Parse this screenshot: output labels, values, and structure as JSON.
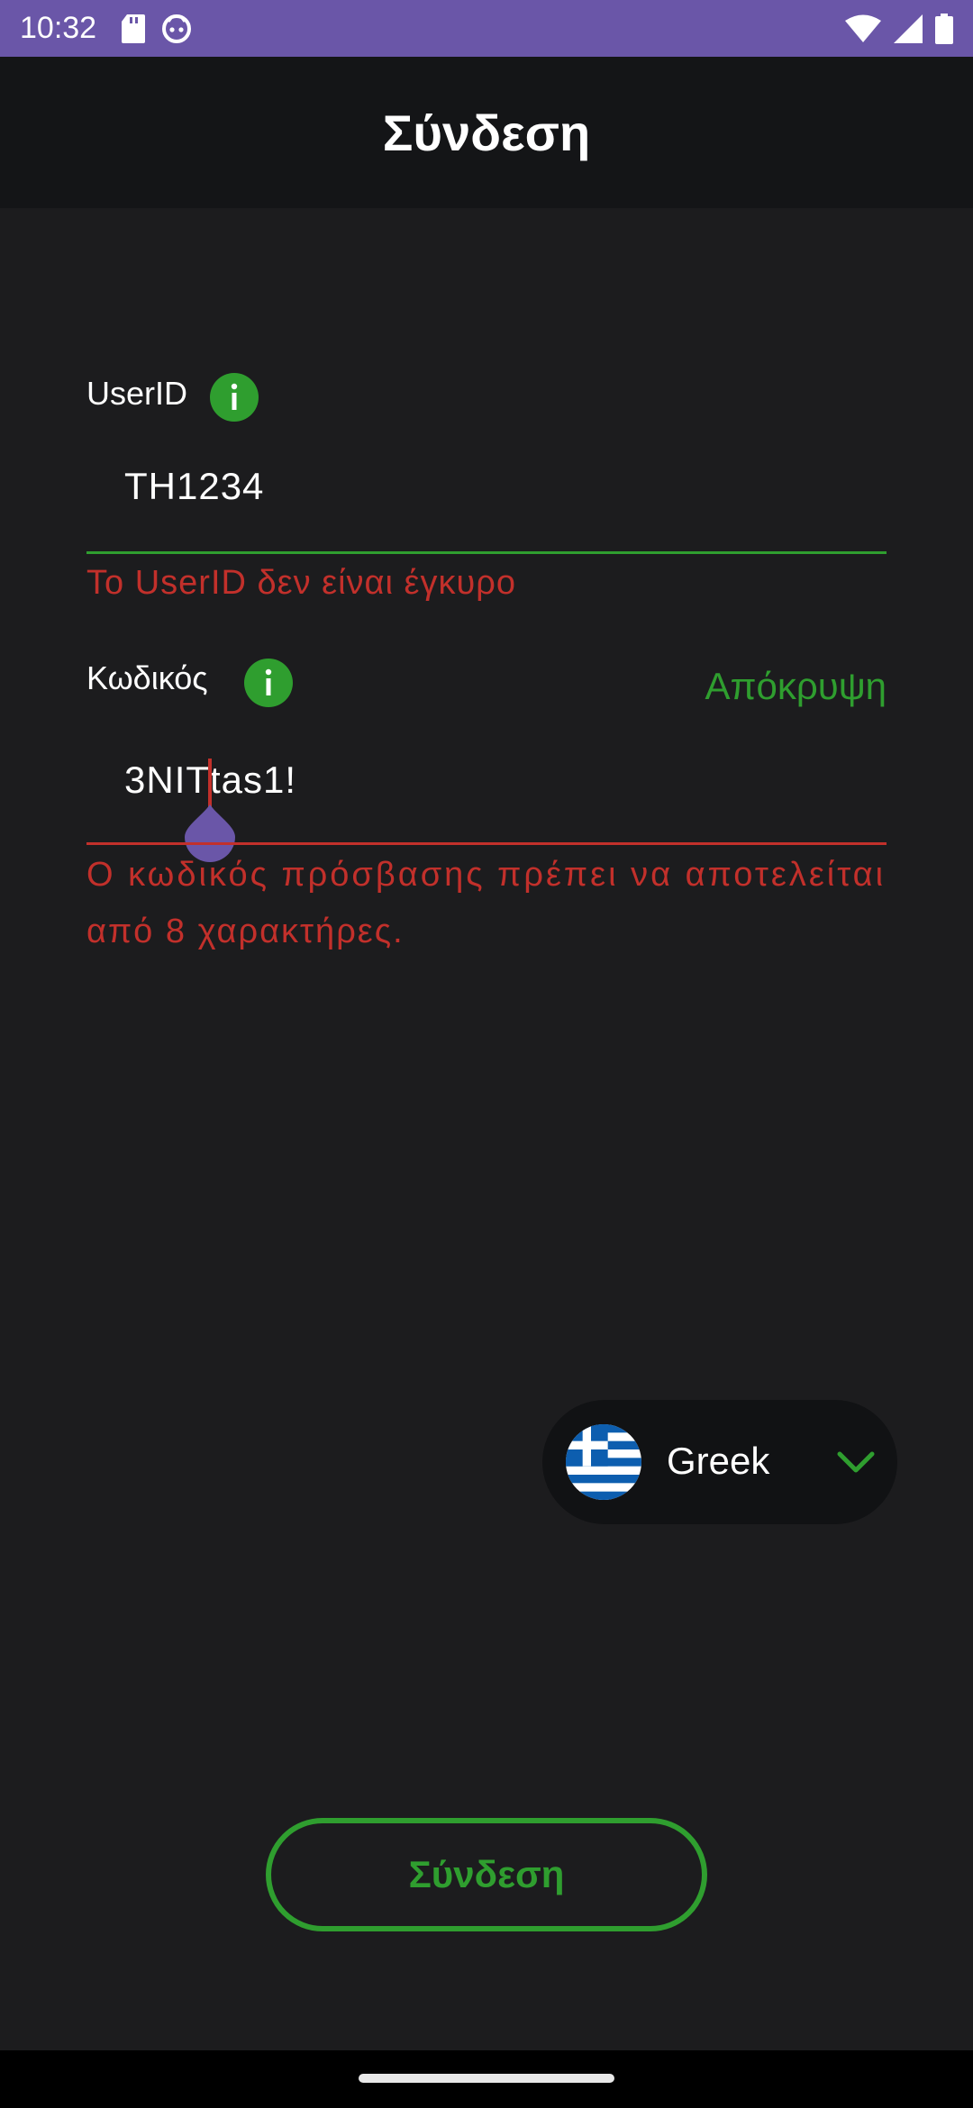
{
  "status_bar": {
    "time": "10:32"
  },
  "app_bar": {
    "title": "Σύνδεση"
  },
  "userid_field": {
    "label": "UserID",
    "value": "TH1234",
    "error": "Το UserID δεν είναι έγκυρο",
    "info_icon": "info-icon"
  },
  "password_field": {
    "label": "Κωδικός",
    "value": "3NITtas1!",
    "toggle": "Απόκρυψη",
    "error_line1": "Ο κωδικός πρόσβασης πρέπει να αποτελείται",
    "error_line2": "από 8 χαρακτήρες.",
    "info_icon": "info-icon"
  },
  "language_selector": {
    "selected": "Greek",
    "flag_icon": "greek-flag-icon",
    "dropdown_icon": "chevron-down-icon"
  },
  "login_button": {
    "label": "Σύνδεση"
  },
  "colors": {
    "accent_green": "#2f9e2f",
    "error_red": "#c2302b",
    "status_bar": "#6a56a8",
    "background": "#1c1c1e",
    "app_bar": "#141517"
  }
}
